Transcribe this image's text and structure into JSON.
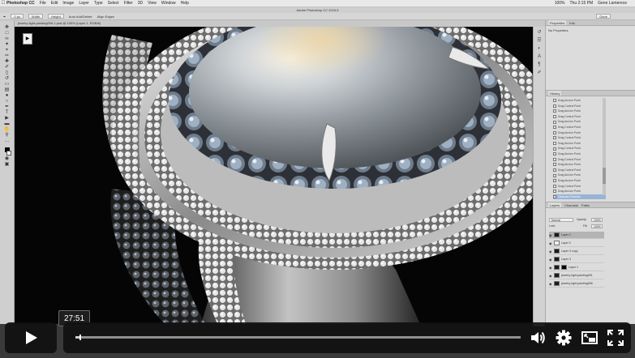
{
  "menubar": {
    "apple": "",
    "app": "Photoshop CC",
    "items": [
      "File",
      "Edit",
      "Image",
      "Layer",
      "Type",
      "Select",
      "Filter",
      "3D",
      "View",
      "Window",
      "Help"
    ],
    "status": [
      "100%",
      "Thu 2:15 PM",
      "Gene Lamerece"
    ]
  },
  "ps_title": "Adobe Photoshop CC 2015.5",
  "options_bar": {
    "feather": "0 px",
    "width": "Width",
    "height": "Height",
    "auto_add": "Auto Add/Delete",
    "align": "Align Edges",
    "workspace": "Gene"
  },
  "document_tab": "jewelry-light-painting006-1.psd @ 100% (Layer 1, RGB/8)",
  "panels": {
    "properties_tabs": [
      "Properties",
      "Info"
    ],
    "properties_text": "No Properties",
    "history_title": "History",
    "history_items": [
      "Drag Anchor Point",
      "Drag Control Point",
      "Drag Anchor Point",
      "Drag Control Point",
      "Drag Anchor Point",
      "Drag Control Point",
      "Drag Anchor Point",
      "Drag Control Point",
      "Drag Anchor Point",
      "Drag Control Point",
      "Drag Anchor Point",
      "Drag Control Point",
      "Drag Anchor Point",
      "Drag Control Point",
      "Drag Anchor Point",
      "Drag Anchor Point",
      "Drag Control Point",
      "Drag Anchor Point",
      "Clipboard Thumbs"
    ],
    "layers_tabs": [
      "Layers",
      "Channels",
      "Paths"
    ],
    "blend_mode": "Normal",
    "opacity_label": "Opacity:",
    "opacity": "100%",
    "lock_label": "Lock:",
    "fill_label": "Fill:",
    "fill": "100%",
    "layers": [
      {
        "name": "Layer 1",
        "selected": true
      },
      {
        "name": "Layer 2",
        "selected": false
      },
      {
        "name": "Layer 3 copy",
        "selected": false
      },
      {
        "name": "Layer 3",
        "selected": false
      },
      {
        "name": "Layer 1",
        "selected": false
      },
      {
        "name": "jewelry-light-painting001",
        "selected": false
      },
      {
        "name": "jewelry-light-painting006",
        "selected": false
      }
    ]
  },
  "player": {
    "time_tooltip": "27:51",
    "progress": 0.01,
    "icons": [
      "play-icon",
      "volume-icon",
      "settings-icon",
      "pip-icon",
      "fullscreen-icon"
    ]
  },
  "colors": {
    "ui_gray": "#d6d6d6",
    "canvas_black": "#050505",
    "player_bg": "#101010",
    "history_selected": "#98b4d6"
  }
}
